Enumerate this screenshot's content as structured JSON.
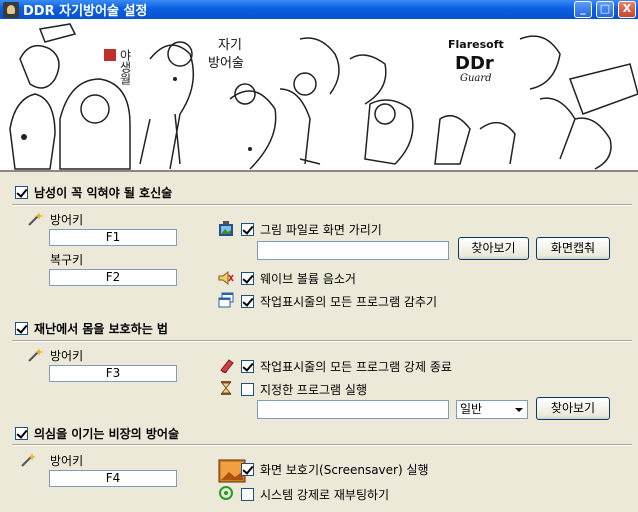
{
  "window": {
    "title": "DDR 자기방어술 설정",
    "min_label": "_",
    "max_label": "□",
    "close_label": "X"
  },
  "banner": {
    "vertical_text": "야생월",
    "center_text_line1": "자기",
    "center_text_line2": "방어술",
    "brand_line1": "Flaresoft",
    "brand_line2": "DDr",
    "brand_line3": "Guard"
  },
  "section1": {
    "title": "남성이 꼭 익혀야 될 호신술",
    "checked": true,
    "defense_key_label": "방어키",
    "defense_key_value": "F1",
    "restore_key_label": "복구키",
    "restore_key_value": "F2",
    "option_picture_label": "그림 파일로 화면 가리기",
    "option_picture_checked": true,
    "picture_path": "",
    "browse_label": "찾아보기",
    "capture_label": "화면캡춰",
    "option_mute_label": "웨이브 볼륨 음소거",
    "option_mute_checked": true,
    "option_hide_label": "작업표시줄의 모든 프로그램 감추기",
    "option_hide_checked": true
  },
  "section2": {
    "title": "재난에서 몸을 보호하는 법",
    "checked": true,
    "defense_key_label": "방어키",
    "defense_key_value": "F3",
    "option_kill_label": "작업표시줄의 모든 프로그램 강제 종료",
    "option_kill_checked": true,
    "option_run_label": "지정한 프로그램 실행",
    "option_run_checked": false,
    "run_path": "",
    "run_mode": "일반",
    "browse_label": "찾아보기"
  },
  "section3": {
    "title": "의심을 이기는 비장의 방어술",
    "checked": true,
    "defense_key_label": "방어키",
    "defense_key_value": "F4",
    "option_screensaver_label": "화면 보호기(Screensaver) 실행",
    "option_screensaver_checked": true,
    "option_reboot_label": "시스템 강제로 재부팅하기",
    "option_reboot_checked": false
  }
}
